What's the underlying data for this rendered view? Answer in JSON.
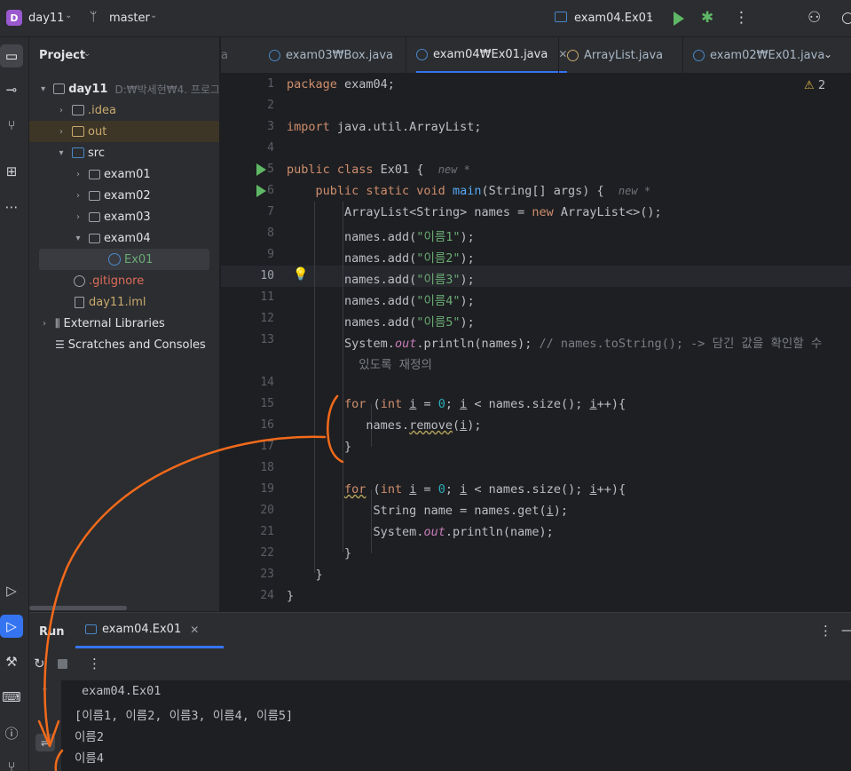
{
  "titlebar": {
    "project_badge": "D",
    "project_name": "day11",
    "branch": "master",
    "run_config": "exam04.Ex01",
    "colors": {
      "run": "#5fb865",
      "debug": "#5fb865"
    }
  },
  "project_panel": {
    "title": "Project",
    "tree": [
      {
        "label": "day11",
        "path": "D:₩박세현₩4. 프로그",
        "depth": 0,
        "arrow": "▾",
        "icon": "folder-icon"
      },
      {
        "label": ".idea",
        "depth": 1,
        "arrow": "›",
        "icon": "folder-icon"
      },
      {
        "label": "out",
        "depth": 1,
        "arrow": "›",
        "icon": "folder-icon",
        "highlight": true
      },
      {
        "label": "src",
        "depth": 1,
        "arrow": "▾",
        "icon": "folder-icon"
      },
      {
        "label": "exam01",
        "depth": 2,
        "arrow": "›",
        "icon": "package-icon"
      },
      {
        "label": "exam02",
        "depth": 2,
        "arrow": "›",
        "icon": "package-icon"
      },
      {
        "label": "exam03",
        "depth": 2,
        "arrow": "›",
        "icon": "package-icon"
      },
      {
        "label": "exam04",
        "depth": 2,
        "arrow": "▾",
        "icon": "package-icon"
      },
      {
        "label": "Ex01",
        "depth": 3,
        "arrow": "",
        "icon": "class-icon",
        "selected": true
      },
      {
        "label": ".gitignore",
        "depth": 1,
        "arrow": "",
        "icon": "ignore-icon"
      },
      {
        "label": "day11.iml",
        "depth": 1,
        "arrow": "",
        "icon": "file-icon"
      },
      {
        "label": "External Libraries",
        "depth": 0,
        "arrow": "›",
        "icon": "library-icon"
      },
      {
        "label": "Scratches and Consoles",
        "depth": 0,
        "arrow": "",
        "icon": "scratches-icon"
      }
    ]
  },
  "tabs": [
    {
      "label": "a",
      "active": false
    },
    {
      "label": "exam03₩Box.java",
      "active": false
    },
    {
      "label": "exam04₩Ex01.java",
      "active": true
    },
    {
      "label": "ArrayList.java",
      "active": false
    },
    {
      "label": "exam02₩Ex01.java",
      "active": false
    }
  ],
  "editor": {
    "warnings_count": "2",
    "current_line": 10,
    "line_numbers": [
      "1",
      "2",
      "3",
      "4",
      "5",
      "6",
      "7",
      "8",
      "9",
      "10",
      "11",
      "12",
      "13",
      "",
      "14",
      "15",
      "16",
      "17",
      "18",
      "19",
      "20",
      "21",
      "22",
      "23",
      "24"
    ],
    "lines": {
      "l1_kw": "package",
      "l1_rest": " exam04;",
      "l3_kw": "import",
      "l3_rest": " java.util.ArrayList;",
      "l5_kw": "public class",
      "l5_rest": " Ex01 {  ",
      "l5_hint": "new *",
      "l6_kw": "public static void",
      "l6_fn": "main",
      "l6_rest": "(String[] args) {  ",
      "l6_hint": "new *",
      "l7_a": "ArrayList<String> names = ",
      "l7_kw": "new",
      "l7_b": " ArrayList<>();",
      "add_prefix": "names.add(",
      "add_suffix": ");",
      "s1": "\"이름1\"",
      "s2": "\"이름2\"",
      "s3": "\"이름3\"",
      "s4": "\"이름4\"",
      "s5": "\"이름5\"",
      "l13_a": "System.",
      "l13_out": "out",
      "l13_b": ".println(names); ",
      "l13_cmt": "// names.toString(); -> 담긴 값을 확인할 수",
      "l13_cmt2": "있도록 재정의",
      "for_kw": "for",
      "for_a": " (",
      "for_int": "int",
      "for_b": " ",
      "for_i": "i",
      "for_c": " = ",
      "for_zero": "0",
      "for_d": "; ",
      "for_e": " < names.size(); ",
      "for_f": "++){",
      "l16_a": "names.",
      "l16_fn": "remove",
      "l16_b": "(",
      "l16_c": ");",
      "close": "}",
      "l20_a": "String name = names.get(",
      "l20_b": ");",
      "l21_a": "System.",
      "l21_b": ".println(name);"
    }
  },
  "run_panel": {
    "title": "Run",
    "tab_label": "exam04.Ex01",
    "output": [
      "exam04.Ex01",
      "[이름1, 이름2, 이름3, 이름4, 이름5]",
      "이름2",
      "이름4"
    ]
  }
}
